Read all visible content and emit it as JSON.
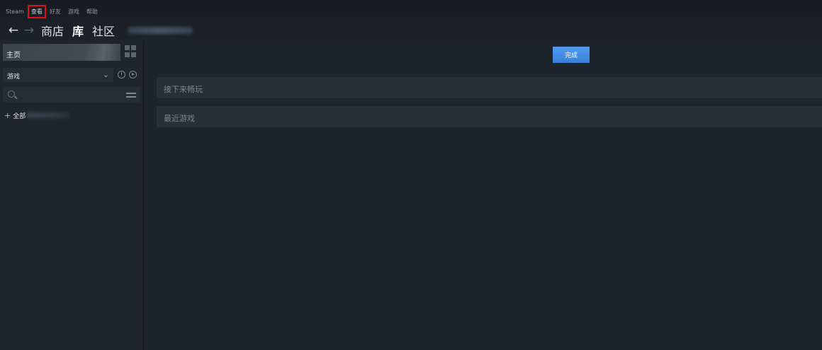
{
  "menu": {
    "items": [
      {
        "label": "Steam"
      },
      {
        "label": "查看",
        "selected": true
      },
      {
        "label": "好友"
      },
      {
        "label": "游戏"
      },
      {
        "label": "帮助"
      }
    ]
  },
  "nav": {
    "back_icon": "←",
    "forward_icon": "→",
    "links": [
      "商店",
      "库",
      "社区"
    ],
    "active_link": "库"
  },
  "sidebar": {
    "home_label": "主页",
    "filter_label": "游戏",
    "chevron": "⌄",
    "search_placeholder": "",
    "all_label": "全部",
    "all_plus": "+"
  },
  "main": {
    "done_label": "完成",
    "shelves": [
      "接下来畅玩",
      "最近游戏"
    ]
  },
  "colors": {
    "accent": "#3d87e0",
    "highlight_outline": "#e01010",
    "background": "#1b2028"
  }
}
